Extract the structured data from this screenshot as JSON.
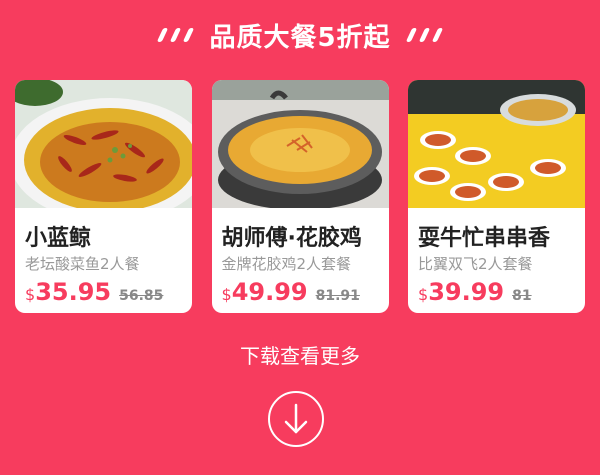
{
  "header": {
    "title": "品质大餐5折起"
  },
  "cards": [
    {
      "name": "小蓝鲸",
      "desc": "老坛酸菜鱼2人餐",
      "currency": "$",
      "price": "35.95",
      "original": "56.85"
    },
    {
      "name": "胡师傅·花胶鸡",
      "desc": "金牌花胶鸡2人套餐",
      "currency": "$",
      "price": "49.99",
      "original": "81.91"
    },
    {
      "name": "耍牛忙串串香",
      "desc": "比翼双飞2人套餐",
      "currency": "$",
      "price": "39.99",
      "original": "81"
    }
  ],
  "footer": {
    "more_label": "下载查看更多",
    "icon": "down-arrow-circle-icon"
  },
  "colors": {
    "accent": "#f73c5e",
    "price": "#f73c5e"
  }
}
